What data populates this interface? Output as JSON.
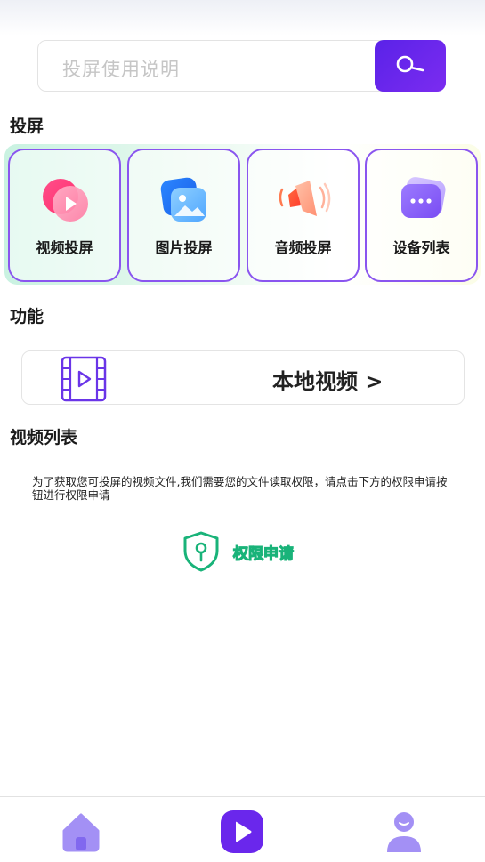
{
  "search": {
    "placeholder": "投屏使用说明"
  },
  "sections": {
    "cast_title": "投屏",
    "function_title": "功能",
    "video_list_title": "视频列表"
  },
  "cast_cards": [
    {
      "label": "视频投屏",
      "icon": "video-play-icon"
    },
    {
      "label": "图片投屏",
      "icon": "image-icon"
    },
    {
      "label": "音频投屏",
      "icon": "speaker-icon"
    },
    {
      "label": "设备列表",
      "icon": "device-chat-icon"
    }
  ],
  "functions": {
    "local_video_label": "本地视频 >"
  },
  "video_list": {
    "notice": "为了获取您可投屏的视频文件,我们需要您的文件读取权限，请点击下方的权限申请按钮进行权限申请",
    "permission_button_label": "权限申请"
  },
  "bottom_nav": [
    {
      "name": "home",
      "icon": "home-icon"
    },
    {
      "name": "play",
      "icon": "play-icon"
    },
    {
      "name": "profile",
      "icon": "user-icon"
    }
  ],
  "colors": {
    "accent": "#6a27ec",
    "card_border": "#8a55ef",
    "permission_green": "#19b379",
    "nav_purple": "#a390f5"
  }
}
